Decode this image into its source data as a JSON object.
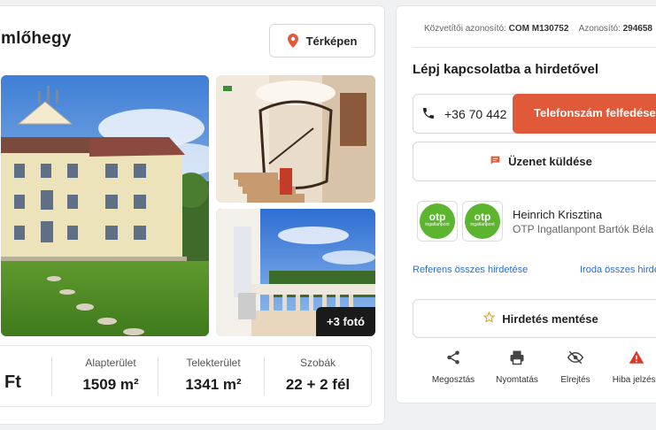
{
  "listing": {
    "title": "mlőhegy",
    "map_button": "Térképen",
    "more_photos": "+3 fotó"
  },
  "stats": {
    "price_suffix": "Ft",
    "items": [
      {
        "label": "Alapterület",
        "value": "1509 m²"
      },
      {
        "label": "Telekterület",
        "value": "1341 m²"
      },
      {
        "label": "Szobák",
        "value": "22 + 2 fél"
      }
    ]
  },
  "ids": {
    "broker_label": "Közvetítői azonosító:",
    "broker_value": "COM M130752",
    "id_label": "Azonosító:",
    "id_value": "294658"
  },
  "contact": {
    "title": "Lépj kapcsolatba a hirdetővel",
    "phone": "+36 70 442",
    "reveal_button": "Telefonszám felfedése",
    "message_button": "Üzenet küldése"
  },
  "agent": {
    "name": "Heinrich Krisztina",
    "office": "OTP Ingatlanpont Bartók Béla út",
    "logo_text": "otp",
    "logo_subtext": "ingatlanpont"
  },
  "links": {
    "agent_all": "Referens összes hirdetése",
    "office_all": "Iroda összes hirdetése"
  },
  "save_button": "Hirdetés mentése",
  "actions": [
    {
      "label": "Megosztás",
      "icon": "share-icon"
    },
    {
      "label": "Nyomtatás",
      "icon": "print-icon"
    },
    {
      "label": "Elrejtés",
      "icon": "hide-icon"
    },
    {
      "label": "Hiba jelzése",
      "icon": "warning-icon"
    }
  ],
  "colors": {
    "accent": "#e05a3a",
    "link": "#2c6ecb",
    "otp_green": "#5cb52e"
  }
}
